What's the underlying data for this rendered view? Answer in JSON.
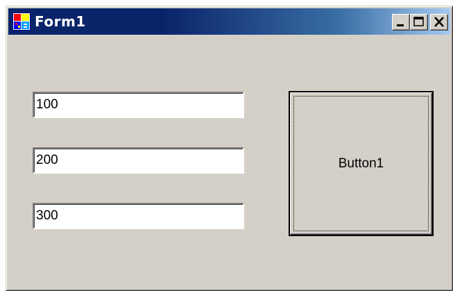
{
  "window": {
    "title": "Form1",
    "icon": "form-app-icon",
    "controls": {
      "minimize_icon": "minimize-icon",
      "maximize_icon": "maximize-icon",
      "close_icon": "close-icon"
    }
  },
  "form": {
    "textboxes": [
      {
        "value": "100"
      },
      {
        "value": "200"
      },
      {
        "value": "300"
      }
    ],
    "button1": {
      "label": "Button1"
    }
  },
  "colors": {
    "titlebar_start": "#0a246a",
    "titlebar_end": "#a6caf0",
    "face": "#d4d0c8"
  }
}
